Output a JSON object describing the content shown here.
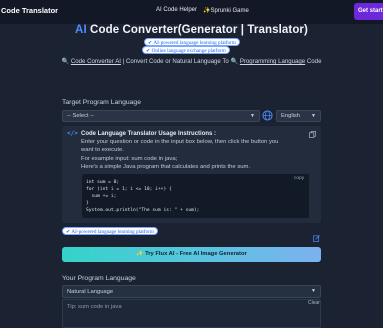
{
  "header": {
    "brand": "Code Translator",
    "nav": [
      "AI Code Helper",
      "✨Sprunki Game"
    ],
    "cta": "Get start"
  },
  "hero": {
    "title_ai": "AI",
    "title_rest": " Code Converter(Generator | Translator)",
    "pill_1": "AI-powered language learning platform",
    "pill_2": "Online language exchange platform",
    "subtitle_link_1": "Code Converter AI",
    "subtitle_mid": " | Convert Code or Natural Language To ",
    "subtitle_link_2": "Programming Language",
    "subtitle_end": " Code"
  },
  "target": {
    "label": "Target Program Language",
    "select_value": "-- Select --",
    "ui_language": "English"
  },
  "instructions": {
    "title": "Code Language Translator Usage Instructions :",
    "line1": "Enter your question or code in the input box below, then click the button you",
    "line2": "want to execute.",
    "line3": "For example input: sum code in java;",
    "line4": "Here's a simple Java program that calculates and prints the sum.",
    "copy_label": "copy",
    "code": [
      "int sum = 0;",
      "for (int i = 1; i <= 10; i++) {",
      "  sum += i;",
      "}",
      "System.out.println(\"The sum is: \" + sum);"
    ]
  },
  "pill_3": "AI-powered language learning platform",
  "promo_button": "✨ Try Flux AI - Free AI Image Generator",
  "source": {
    "label": "Your Program Language",
    "select_value": "Natural Language",
    "clear_label": "Clear",
    "input_placeholder": "Tip: sum code in java"
  },
  "colors": {
    "background": "#1b2333",
    "accent": "#4f8cff",
    "cta_purple": "#6d28d9"
  },
  "icons": [
    "search-icon",
    "globe-icon",
    "code-icon",
    "copy-icon",
    "edit-icon",
    "checkmark-icon"
  ]
}
